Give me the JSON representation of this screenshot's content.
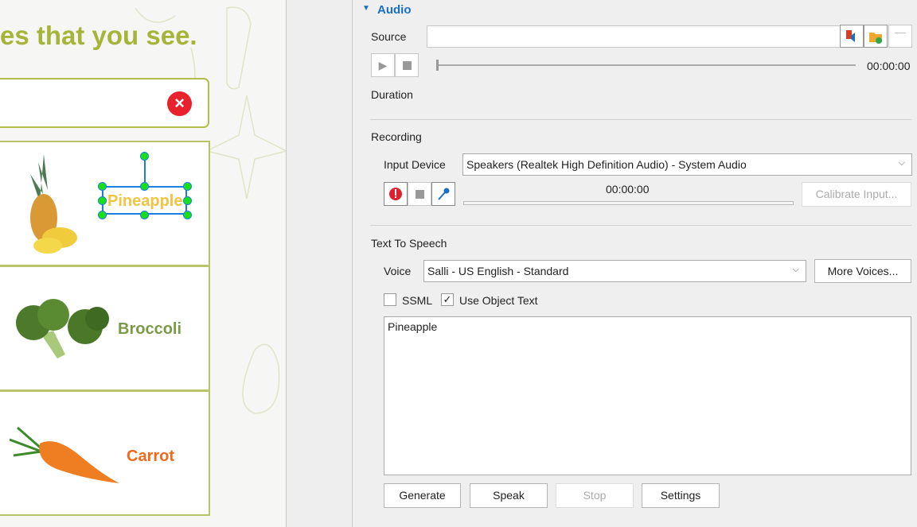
{
  "slide": {
    "instruction_fragment": "es that you see.",
    "items": [
      {
        "label": "Pineapple",
        "color": "#f2c443"
      },
      {
        "label": "Broccoli",
        "color": "#7a9a48"
      },
      {
        "label": "Carrot",
        "color": "#ee6a1c"
      }
    ],
    "close_icon": "×"
  },
  "audio": {
    "section_title": "Audio",
    "source_label": "Source",
    "source_value": "",
    "time": "00:00:00",
    "duration_label": "Duration",
    "progress": 0,
    "recording": {
      "section_title": "Recording",
      "input_device_label": "Input Device",
      "input_device_value": "Speakers (Realtek High Definition Audio) - System Audio",
      "time": "00:00:00",
      "calibrate_label": "Calibrate Input..."
    },
    "tts": {
      "section_title": "Text To Speech",
      "voice_label": "Voice",
      "voice_value": "Salli - US English - Standard",
      "more_voices_label": "More Voices...",
      "ssml_label": "SSML",
      "ssml_checked": false,
      "use_object_text_label": "Use Object Text",
      "use_object_text_checked": true,
      "text": "Pineapple",
      "generate_label": "Generate",
      "speak_label": "Speak",
      "stop_label": "Stop",
      "settings_label": "Settings"
    }
  },
  "colors": {
    "accent": "#1a6fc0",
    "title": "#a6b53a"
  }
}
